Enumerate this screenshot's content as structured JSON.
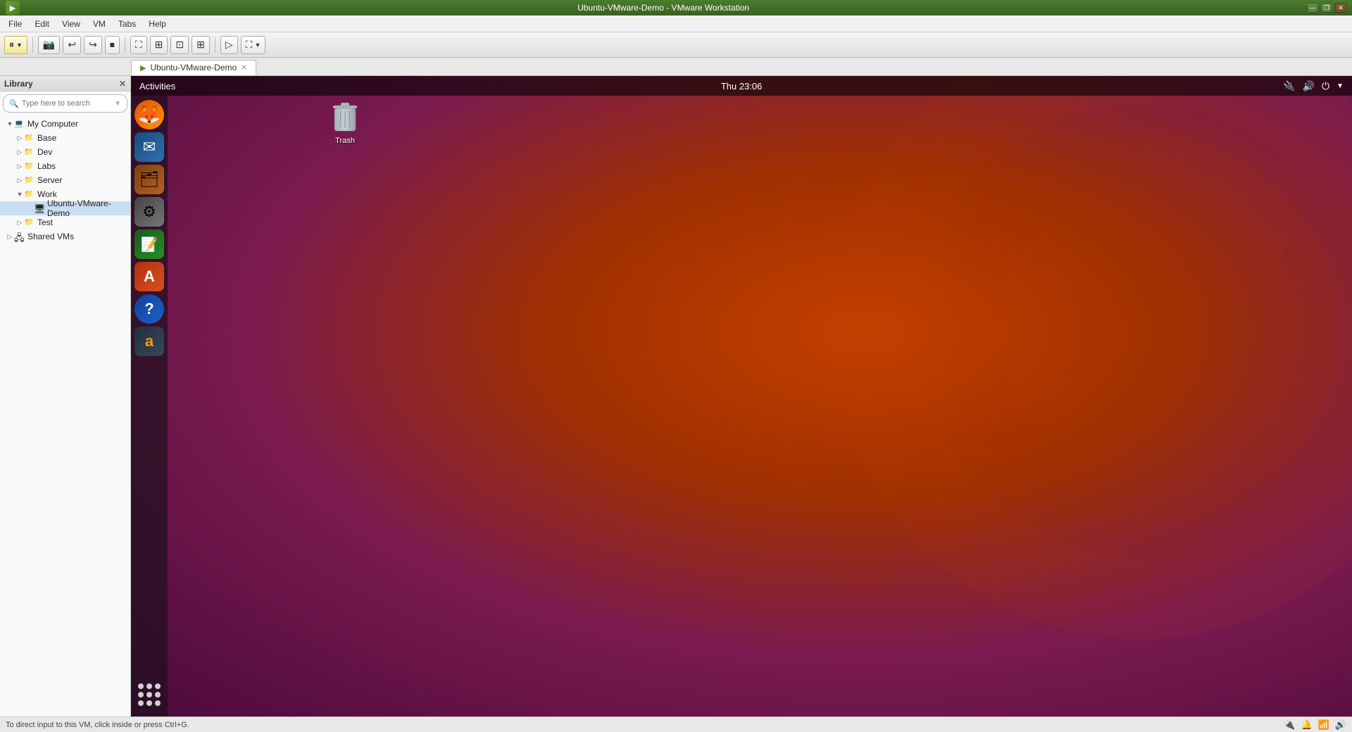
{
  "titlebar": {
    "title": "Ubuntu-VMware-Demo - VMware Workstation",
    "minimize": "—",
    "restore": "❐",
    "close": "✕"
  },
  "menubar": {
    "items": [
      "File",
      "Edit",
      "View",
      "VM",
      "Tabs",
      "Help"
    ]
  },
  "toolbar": {
    "suspend_label": "⏸",
    "buttons": [
      "⏸",
      "⎙",
      "↩",
      "↪",
      "⏹",
      "⛶",
      "⊞",
      "⊡",
      "⊞",
      "⛶",
      "▷",
      "⛶"
    ]
  },
  "tabbar": {
    "tab_label": "Ubuntu-VMware-Demo",
    "tab_close": "✕"
  },
  "library": {
    "header": "Library",
    "close": "✕",
    "search_placeholder": "Type here to search",
    "tree": [
      {
        "level": 1,
        "expand": "▼",
        "icon": "💻",
        "label": "My Computer",
        "type": "group"
      },
      {
        "level": 2,
        "expand": "▷",
        "icon": "📁",
        "label": "Base",
        "type": "folder"
      },
      {
        "level": 2,
        "expand": "▷",
        "icon": "📁",
        "label": "Dev",
        "type": "folder"
      },
      {
        "level": 2,
        "expand": "▷",
        "icon": "📁",
        "label": "Labs",
        "type": "folder"
      },
      {
        "level": 2,
        "expand": "▷",
        "icon": "📁",
        "label": "Server",
        "type": "folder"
      },
      {
        "level": 2,
        "expand": "▼",
        "icon": "📁",
        "label": "Work",
        "type": "folder"
      },
      {
        "level": 3,
        "expand": "",
        "icon": "🖥",
        "label": "Ubuntu-VMware-Demo",
        "type": "vm",
        "selected": true
      },
      {
        "level": 2,
        "expand": "▷",
        "icon": "📁",
        "label": "Test",
        "type": "folder"
      },
      {
        "level": 1,
        "expand": "▷",
        "icon": "🖧",
        "label": "Shared VMs",
        "type": "group"
      }
    ]
  },
  "ubuntu": {
    "topbar_left": "Activities",
    "clock": "Thu 23:06",
    "icons": [
      {
        "name": "firefox",
        "label": "Firefox",
        "css_class": "icon-firefox",
        "symbol": "🦊"
      },
      {
        "name": "mail",
        "label": "Thunderbird",
        "css_class": "icon-mail",
        "symbol": "✉"
      },
      {
        "name": "files",
        "label": "Files",
        "css_class": "icon-files",
        "symbol": "🗂"
      },
      {
        "name": "settings",
        "label": "System Settings",
        "css_class": "icon-settings",
        "symbol": "⚙"
      },
      {
        "name": "libreoffice",
        "label": "LibreOffice",
        "css_class": "icon-libreoffice",
        "symbol": "📝"
      },
      {
        "name": "software",
        "label": "Software Center",
        "css_class": "icon-software",
        "symbol": "A"
      },
      {
        "name": "help",
        "label": "Help",
        "css_class": "icon-help",
        "symbol": "?"
      },
      {
        "name": "amazon",
        "label": "Amazon",
        "css_class": "icon-amazon",
        "symbol": "a"
      }
    ],
    "trash_label": "Trash"
  },
  "statusbar": {
    "message": "To direct input to this VM, click inside or press Ctrl+G.",
    "right_icons": [
      "🔌",
      "🔔",
      "📶",
      "🔊"
    ]
  }
}
